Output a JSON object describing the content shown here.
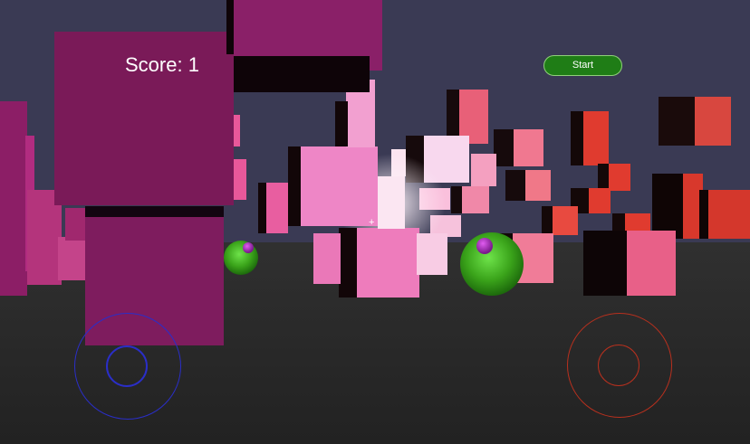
{
  "hud": {
    "score_text": "Score: 1",
    "start_label": "Start",
    "crosshair": "+"
  },
  "colors": {
    "sky": "#3a3a54",
    "floor": "#262626",
    "start_button": "#1f7d16",
    "left_joystick": "#2a2ec8",
    "right_joystick": "#b8301e",
    "sphere_body": "#3aa31a",
    "sphere_eye": "#a12ab8"
  },
  "scene": {
    "objects": [
      "purple-cubes",
      "pink-cubes",
      "red-cubes",
      "green-spheres"
    ]
  },
  "controls": {
    "left": "move-joystick",
    "right": "look-joystick"
  }
}
